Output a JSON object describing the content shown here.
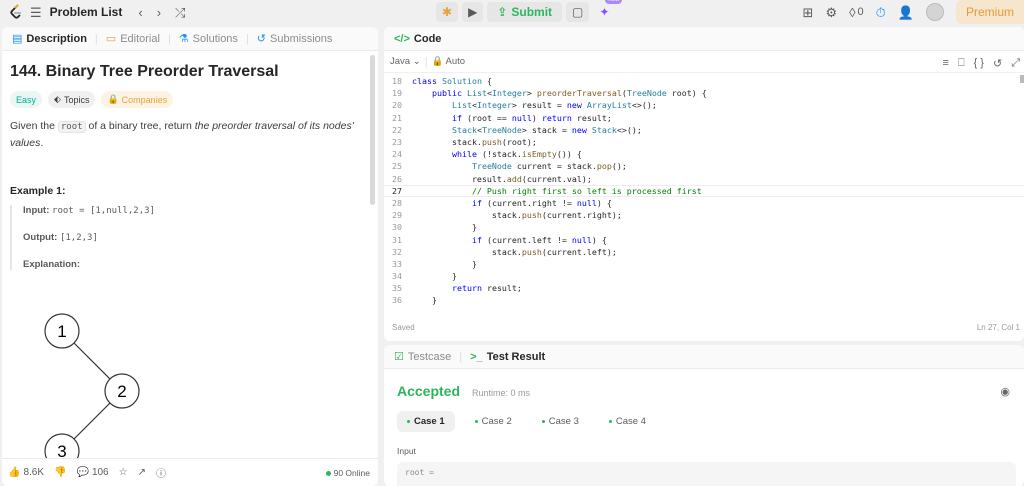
{
  "topbar": {
    "problem_list": "Problem List",
    "submit": "Submit",
    "badge": "new",
    "streak": "0",
    "premium": "Premium",
    "icons": [
      "logo-icon",
      "list-icon",
      "chevron-left-icon",
      "chevron-right-icon",
      "shuffle-icon",
      "debug-icon",
      "play-icon",
      "cloud-upload-icon",
      "note-icon",
      "sparkle-icon",
      "layout-icon",
      "gear-icon",
      "fire-icon",
      "timer-icon",
      "add-user-icon",
      "avatar"
    ]
  },
  "left": {
    "tabs": [
      {
        "label": "Description",
        "icon": "document-icon"
      },
      {
        "label": "Editorial",
        "icon": "book-icon"
      },
      {
        "label": "Solutions",
        "icon": "flask-icon"
      },
      {
        "label": "Submissions",
        "icon": "history-icon"
      }
    ],
    "title": "144. Binary Tree Preorder Traversal",
    "chips": {
      "difficulty": "Easy",
      "topics": "Topics",
      "companies": "Companies"
    },
    "desc_prefix": "Given the ",
    "desc_code": "root",
    "desc_middle": " of a binary tree, return ",
    "desc_em": "the preorder traversal of its nodes' values",
    "desc_suffix": ".",
    "example_title": "Example 1:",
    "input_label": "Input:",
    "input_value": "root = [1,null,2,3]",
    "output_label": "Output:",
    "output_value": "[1,2,3]",
    "explanation_label": "Explanation:",
    "tree_nodes": [
      "1",
      "2",
      "3"
    ],
    "footer": {
      "likes": "8.6K",
      "comments": "106",
      "online": "90 Online"
    }
  },
  "code": {
    "tab": "Code",
    "language": "Java",
    "mode": "Auto",
    "lines": [
      {
        "n": "18",
        "t": "class Solution {"
      },
      {
        "n": "19",
        "t": "    public List<Integer> preorderTraversal(TreeNode root) {"
      },
      {
        "n": "20",
        "t": "        List<Integer> result = new ArrayList<>();"
      },
      {
        "n": "21",
        "t": "        if (root == null) return result;"
      },
      {
        "n": "22",
        "t": "        Stack<TreeNode> stack = new Stack<>();"
      },
      {
        "n": "23",
        "t": "        stack.push(root);"
      },
      {
        "n": "24",
        "t": "        while (!stack.isEmpty()) {"
      },
      {
        "n": "25",
        "t": "            TreeNode current = stack.pop();"
      },
      {
        "n": "26",
        "t": "            result.add(current.val);"
      },
      {
        "n": "27",
        "t": "            // Push right first so left is processed first"
      },
      {
        "n": "28",
        "t": "            if (current.right != null) {"
      },
      {
        "n": "29",
        "t": "                stack.push(current.right);"
      },
      {
        "n": "30",
        "t": "            }"
      },
      {
        "n": "31",
        "t": "            if (current.left != null) {"
      },
      {
        "n": "32",
        "t": "                stack.push(current.left);"
      },
      {
        "n": "33",
        "t": "            }"
      },
      {
        "n": "34",
        "t": "        }"
      },
      {
        "n": "35",
        "t": "        return result;"
      },
      {
        "n": "36",
        "t": "    }"
      }
    ],
    "saved": "Saved",
    "cursor": "Ln 27, Col 1"
  },
  "result": {
    "tabs": [
      {
        "label": "Testcase",
        "icon": "checkbox-icon"
      },
      {
        "label": "Test Result",
        "icon": "terminal-icon"
      }
    ],
    "status": "Accepted",
    "runtime": "Runtime: 0 ms",
    "cases": [
      "Case 1",
      "Case 2",
      "Case 3",
      "Case 4"
    ],
    "input_label": "Input",
    "input_preview": "root ="
  },
  "colors": {
    "accent_green": "#2db55d",
    "easy": "#00af9b",
    "premium": "#e69b34"
  }
}
